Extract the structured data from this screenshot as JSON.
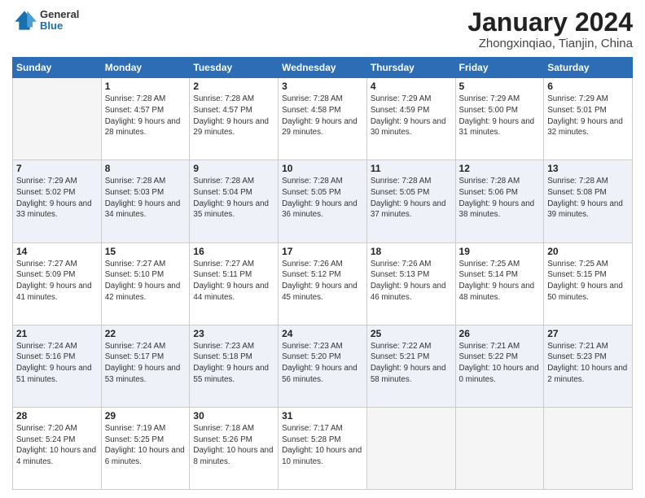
{
  "header": {
    "logo": {
      "general": "General",
      "blue": "Blue"
    },
    "title": "January 2024",
    "location": "Zhongxinqiao, Tianjin, China"
  },
  "weekdays": [
    "Sunday",
    "Monday",
    "Tuesday",
    "Wednesday",
    "Thursday",
    "Friday",
    "Saturday"
  ],
  "weeks": [
    [
      {
        "day": "",
        "sunrise": "",
        "sunset": "",
        "daylight": "",
        "empty": true
      },
      {
        "day": "1",
        "sunrise": "Sunrise: 7:28 AM",
        "sunset": "Sunset: 4:57 PM",
        "daylight": "Daylight: 9 hours and 28 minutes."
      },
      {
        "day": "2",
        "sunrise": "Sunrise: 7:28 AM",
        "sunset": "Sunset: 4:57 PM",
        "daylight": "Daylight: 9 hours and 29 minutes."
      },
      {
        "day": "3",
        "sunrise": "Sunrise: 7:28 AM",
        "sunset": "Sunset: 4:58 PM",
        "daylight": "Daylight: 9 hours and 29 minutes."
      },
      {
        "day": "4",
        "sunrise": "Sunrise: 7:29 AM",
        "sunset": "Sunset: 4:59 PM",
        "daylight": "Daylight: 9 hours and 30 minutes."
      },
      {
        "day": "5",
        "sunrise": "Sunrise: 7:29 AM",
        "sunset": "Sunset: 5:00 PM",
        "daylight": "Daylight: 9 hours and 31 minutes."
      },
      {
        "day": "6",
        "sunrise": "Sunrise: 7:29 AM",
        "sunset": "Sunset: 5:01 PM",
        "daylight": "Daylight: 9 hours and 32 minutes."
      }
    ],
    [
      {
        "day": "7",
        "sunrise": "Sunrise: 7:29 AM",
        "sunset": "Sunset: 5:02 PM",
        "daylight": "Daylight: 9 hours and 33 minutes."
      },
      {
        "day": "8",
        "sunrise": "Sunrise: 7:28 AM",
        "sunset": "Sunset: 5:03 PM",
        "daylight": "Daylight: 9 hours and 34 minutes."
      },
      {
        "day": "9",
        "sunrise": "Sunrise: 7:28 AM",
        "sunset": "Sunset: 5:04 PM",
        "daylight": "Daylight: 9 hours and 35 minutes."
      },
      {
        "day": "10",
        "sunrise": "Sunrise: 7:28 AM",
        "sunset": "Sunset: 5:05 PM",
        "daylight": "Daylight: 9 hours and 36 minutes."
      },
      {
        "day": "11",
        "sunrise": "Sunrise: 7:28 AM",
        "sunset": "Sunset: 5:05 PM",
        "daylight": "Daylight: 9 hours and 37 minutes."
      },
      {
        "day": "12",
        "sunrise": "Sunrise: 7:28 AM",
        "sunset": "Sunset: 5:06 PM",
        "daylight": "Daylight: 9 hours and 38 minutes."
      },
      {
        "day": "13",
        "sunrise": "Sunrise: 7:28 AM",
        "sunset": "Sunset: 5:08 PM",
        "daylight": "Daylight: 9 hours and 39 minutes."
      }
    ],
    [
      {
        "day": "14",
        "sunrise": "Sunrise: 7:27 AM",
        "sunset": "Sunset: 5:09 PM",
        "daylight": "Daylight: 9 hours and 41 minutes."
      },
      {
        "day": "15",
        "sunrise": "Sunrise: 7:27 AM",
        "sunset": "Sunset: 5:10 PM",
        "daylight": "Daylight: 9 hours and 42 minutes."
      },
      {
        "day": "16",
        "sunrise": "Sunrise: 7:27 AM",
        "sunset": "Sunset: 5:11 PM",
        "daylight": "Daylight: 9 hours and 44 minutes."
      },
      {
        "day": "17",
        "sunrise": "Sunrise: 7:26 AM",
        "sunset": "Sunset: 5:12 PM",
        "daylight": "Daylight: 9 hours and 45 minutes."
      },
      {
        "day": "18",
        "sunrise": "Sunrise: 7:26 AM",
        "sunset": "Sunset: 5:13 PM",
        "daylight": "Daylight: 9 hours and 46 minutes."
      },
      {
        "day": "19",
        "sunrise": "Sunrise: 7:25 AM",
        "sunset": "Sunset: 5:14 PM",
        "daylight": "Daylight: 9 hours and 48 minutes."
      },
      {
        "day": "20",
        "sunrise": "Sunrise: 7:25 AM",
        "sunset": "Sunset: 5:15 PM",
        "daylight": "Daylight: 9 hours and 50 minutes."
      }
    ],
    [
      {
        "day": "21",
        "sunrise": "Sunrise: 7:24 AM",
        "sunset": "Sunset: 5:16 PM",
        "daylight": "Daylight: 9 hours and 51 minutes."
      },
      {
        "day": "22",
        "sunrise": "Sunrise: 7:24 AM",
        "sunset": "Sunset: 5:17 PM",
        "daylight": "Daylight: 9 hours and 53 minutes."
      },
      {
        "day": "23",
        "sunrise": "Sunrise: 7:23 AM",
        "sunset": "Sunset: 5:18 PM",
        "daylight": "Daylight: 9 hours and 55 minutes."
      },
      {
        "day": "24",
        "sunrise": "Sunrise: 7:23 AM",
        "sunset": "Sunset: 5:20 PM",
        "daylight": "Daylight: 9 hours and 56 minutes."
      },
      {
        "day": "25",
        "sunrise": "Sunrise: 7:22 AM",
        "sunset": "Sunset: 5:21 PM",
        "daylight": "Daylight: 9 hours and 58 minutes."
      },
      {
        "day": "26",
        "sunrise": "Sunrise: 7:21 AM",
        "sunset": "Sunset: 5:22 PM",
        "daylight": "Daylight: 10 hours and 0 minutes."
      },
      {
        "day": "27",
        "sunrise": "Sunrise: 7:21 AM",
        "sunset": "Sunset: 5:23 PM",
        "daylight": "Daylight: 10 hours and 2 minutes."
      }
    ],
    [
      {
        "day": "28",
        "sunrise": "Sunrise: 7:20 AM",
        "sunset": "Sunset: 5:24 PM",
        "daylight": "Daylight: 10 hours and 4 minutes."
      },
      {
        "day": "29",
        "sunrise": "Sunrise: 7:19 AM",
        "sunset": "Sunset: 5:25 PM",
        "daylight": "Daylight: 10 hours and 6 minutes."
      },
      {
        "day": "30",
        "sunrise": "Sunrise: 7:18 AM",
        "sunset": "Sunset: 5:26 PM",
        "daylight": "Daylight: 10 hours and 8 minutes."
      },
      {
        "day": "31",
        "sunrise": "Sunrise: 7:17 AM",
        "sunset": "Sunset: 5:28 PM",
        "daylight": "Daylight: 10 hours and 10 minutes."
      },
      {
        "day": "",
        "sunrise": "",
        "sunset": "",
        "daylight": "",
        "empty": true
      },
      {
        "day": "",
        "sunrise": "",
        "sunset": "",
        "daylight": "",
        "empty": true
      },
      {
        "day": "",
        "sunrise": "",
        "sunset": "",
        "daylight": "",
        "empty": true
      }
    ]
  ]
}
